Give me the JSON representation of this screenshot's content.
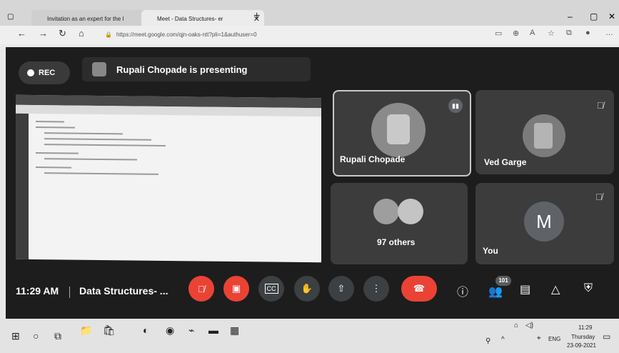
{
  "browser": {
    "tabs": [
      {
        "label": "Invitation as an expert for the I"
      },
      {
        "label": "Meet - Data Structures- er"
      }
    ],
    "url": "https://meet.google.com/qjn-oaks-ntt?pli=1&authuser=0",
    "new_tab": "+",
    "window_controls": {
      "minimize": "–",
      "maximize": "▢",
      "close": "✕"
    }
  },
  "meet": {
    "rec_label": "REC",
    "presenting_label": "Rupali Chopade is presenting",
    "participants": [
      {
        "name": "Rupali Chopade",
        "speaking": true
      },
      {
        "name": "Ved Garge",
        "muted": true
      },
      {
        "name": "97 others"
      },
      {
        "name": "You",
        "initial": "M",
        "muted": true
      }
    ],
    "time": "11:29 AM",
    "meeting_title": "Data Structures- ...",
    "people_count": "101",
    "controls": [
      "mic-off",
      "camera-off",
      "captions",
      "raise-hand",
      "present",
      "more",
      "leave"
    ],
    "right_controls": [
      "info",
      "people",
      "chat",
      "activities",
      "host-controls"
    ],
    "colors": {
      "leave": "#ea4335",
      "accent": "#8ab4f8",
      "you_avatar": "#5f6368"
    }
  },
  "taskbar": {
    "language": "ENG",
    "time": "11:29",
    "day": "Thursday",
    "date": "23-09-2021"
  }
}
